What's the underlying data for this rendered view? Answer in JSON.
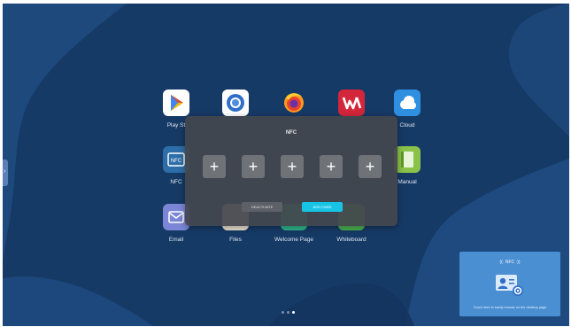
{
  "apps": [
    {
      "id": "play",
      "label": "Play St",
      "icon": "play-store-icon",
      "color": "#ffffff"
    },
    {
      "id": "chrome",
      "label": "",
      "icon": "browser-icon",
      "color": "#ffffff"
    },
    {
      "id": "firefox",
      "label": "",
      "icon": "firefox-icon",
      "color": "#e8442d"
    },
    {
      "id": "wps",
      "label": "",
      "icon": "wps-office-icon",
      "color": "#d3263a"
    },
    {
      "id": "cloud",
      "label": "Cloud",
      "icon": "cloud-icon",
      "color": "#2f8fe0"
    },
    {
      "id": "nfc",
      "label": "NFC",
      "icon": "nfc-icon",
      "color": "#2e6ea8"
    },
    {
      "id": "manual",
      "label": "Manual",
      "icon": "manual-icon",
      "color": "#8bc34a"
    },
    {
      "id": "email",
      "label": "Email",
      "icon": "email-icon",
      "color": "#7b86d6"
    },
    {
      "id": "files",
      "label": "Files",
      "icon": "files-icon",
      "color": "#e9e2cf"
    },
    {
      "id": "welcome",
      "label": "Welcome Page",
      "icon": "welcome-icon",
      "color": "#2fb58c"
    },
    {
      "id": "whiteboard",
      "label": "Whiteboard",
      "icon": "whiteboard-icon",
      "color": "#4caf50"
    }
  ],
  "dialog": {
    "title": "NFC",
    "slot_glyph": "+",
    "secondary_button": "DEACTIVATE",
    "primary_button": "ADD CARD"
  },
  "side_handle": {
    "glyph": "›"
  },
  "nfc_panel": {
    "title": "((· NFC ·))",
    "description": "Touch here to easily browse on the desktop page"
  },
  "page_indicator": {
    "count": 3,
    "active": 2
  },
  "colors": {
    "background": "#163a66",
    "dialog": "#44474d",
    "primary_button": "#18c4e6",
    "panel": "#4a8fd1"
  }
}
